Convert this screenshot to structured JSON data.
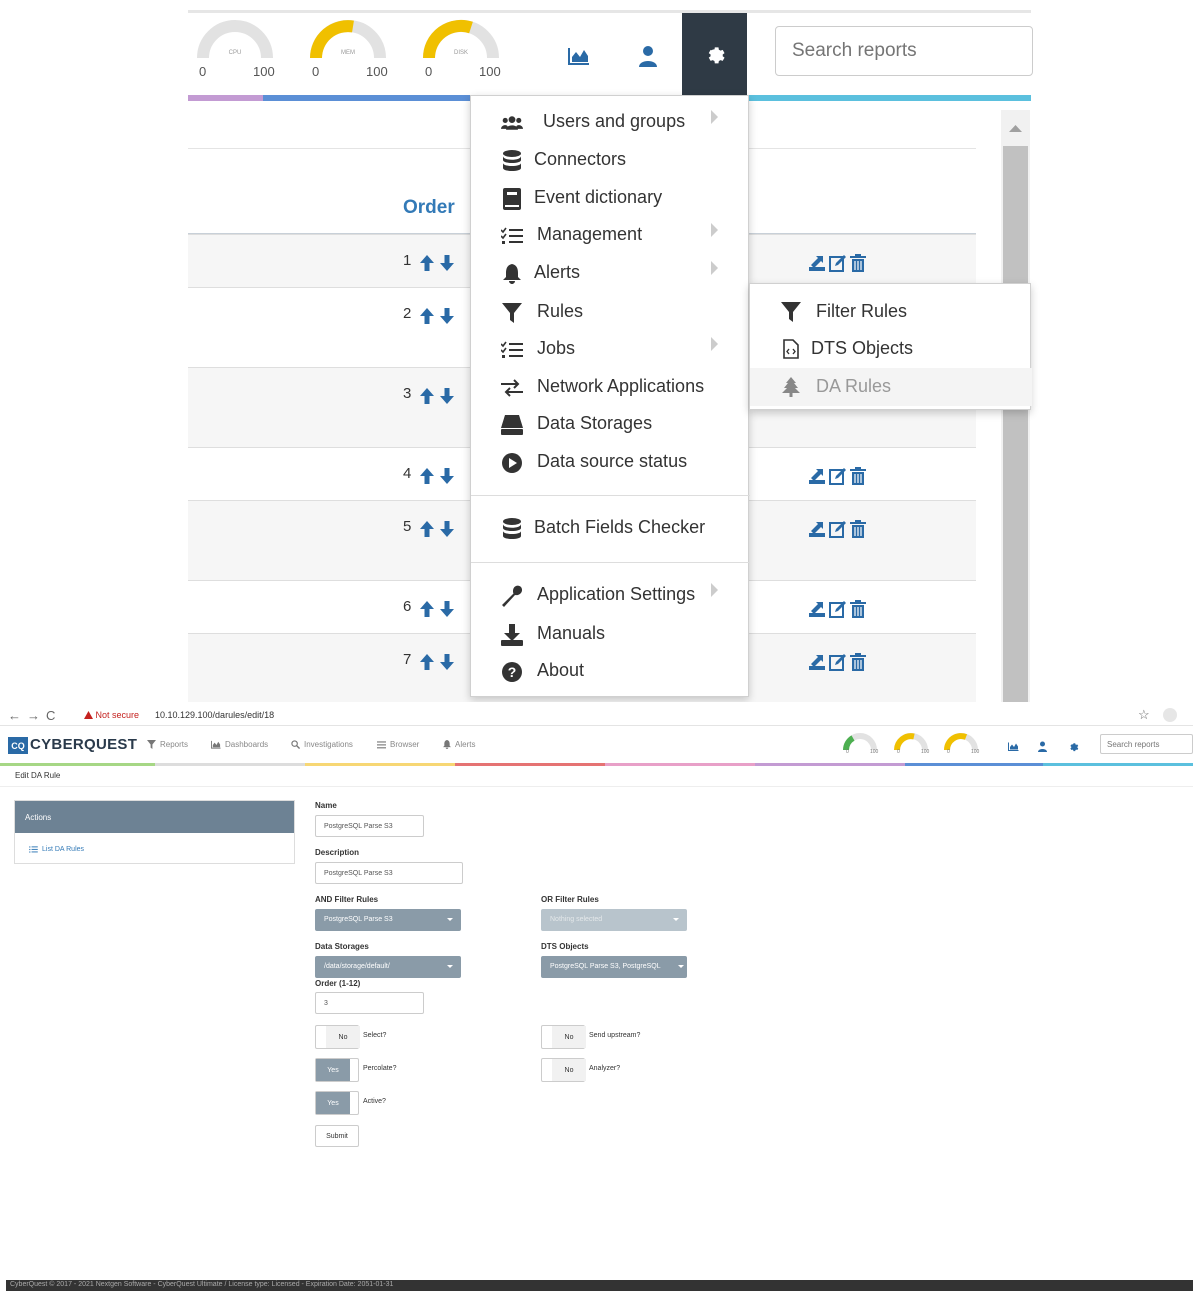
{
  "zoom": {
    "gauges": [
      {
        "label": "CPU",
        "min": "0",
        "max": "100",
        "value": 0,
        "color": "#cccccc"
      },
      {
        "label": "MEM",
        "min": "0",
        "max": "100",
        "value": 0.55,
        "color": "#f0c000"
      },
      {
        "label": "DISK",
        "min": "0",
        "max": "100",
        "value": 0.6,
        "color": "#f0c000"
      }
    ],
    "search_placeholder": "Search reports",
    "table": {
      "order_header": "Order",
      "rows": [
        "1",
        "2",
        "3",
        "4",
        "5",
        "6",
        "7"
      ]
    },
    "menu": {
      "items": [
        {
          "label": "Users and groups",
          "icon": "users-icon",
          "submenu": true
        },
        {
          "label": "Connectors",
          "icon": "database-icon",
          "submenu": false
        },
        {
          "label": "Event dictionary",
          "icon": "book-icon",
          "submenu": false
        },
        {
          "label": "Management",
          "icon": "tasks-icon",
          "submenu": true
        },
        {
          "label": "Alerts",
          "icon": "bell-icon",
          "submenu": true
        },
        {
          "label": "Rules",
          "icon": "filter-icon",
          "submenu": false
        },
        {
          "label": "Jobs",
          "icon": "tasks-icon",
          "submenu": true
        },
        {
          "label": "Network Applications",
          "icon": "exchange-icon",
          "submenu": false
        },
        {
          "label": "Data Storages",
          "icon": "hdd-icon",
          "submenu": false
        },
        {
          "label": "Data source status",
          "icon": "play-circle-icon",
          "submenu": false
        },
        {
          "label": "Batch Fields Checker",
          "icon": "database-icon",
          "submenu": false
        },
        {
          "label": "Application Settings",
          "icon": "wrench-icon",
          "submenu": true
        },
        {
          "label": "Manuals",
          "icon": "download-icon",
          "submenu": false
        },
        {
          "label": "About",
          "icon": "question-circle-icon",
          "submenu": false
        }
      ]
    },
    "submenu": {
      "items": [
        {
          "label": "Filter Rules",
          "icon": "filter-icon"
        },
        {
          "label": "DTS Objects",
          "icon": "file-code-icon"
        },
        {
          "label": "DA Rules",
          "icon": "tree-icon"
        }
      ]
    }
  },
  "browser": {
    "not_secure": "Not secure",
    "url": "10.10.129.100/darules/edit/18"
  },
  "app": {
    "logo_mark": "CQ",
    "logo_text": "CYBERQUEST",
    "nav": {
      "reports": "Reports",
      "dashboards": "Dashboards",
      "investigations": "Investigations",
      "browser": "Browser",
      "alerts": "Alerts"
    },
    "gauge_numbers": {
      "min": "0",
      "max": "100"
    },
    "search_placeholder": "Search reports"
  },
  "page": {
    "title": "Edit DA Rule",
    "actions_title": "Actions",
    "list_link": "List DA Rules"
  },
  "form": {
    "name_label": "Name",
    "name_value": "PostgreSQL Parse S3",
    "description_label": "Description",
    "description_value": "PostgreSQL Parse S3",
    "and_filter_label": "AND Filter Rules",
    "and_filter_value": "PostgreSQL Parse S3",
    "or_filter_label": "OR Filter Rules",
    "or_filter_value": "Nothing selected",
    "data_storages_label": "Data Storages",
    "data_storages_value": "/data/storage/default/",
    "dts_objects_label": "DTS Objects",
    "dts_objects_value": "PostgreSQL Parse S3, PostgreSQL",
    "order_label": "Order (1-12)",
    "order_value": "3",
    "select_state": "No",
    "select_label": "Select?",
    "send_upstream_state": "No",
    "send_upstream_label": "Send upstream?",
    "percolate_state": "Yes",
    "percolate_label": "Percolate?",
    "analyzer_state": "No",
    "analyzer_label": "Analyzer?",
    "active_state": "Yes",
    "active_label": "Active?",
    "submit_label": "Submit"
  },
  "footer": {
    "text": "CyberQuest © 2017 - 2021 Nextgen Software - CyberQuest Ultimate / License type: Licensed - Expiration Date: 2051-01-31"
  },
  "colors": {
    "accent": "#337ab7",
    "dark": "#2f3a45",
    "panel": "#6d8294",
    "toggle_on": "#8a9ba8",
    "gauge_yellow": "#f0c000"
  }
}
